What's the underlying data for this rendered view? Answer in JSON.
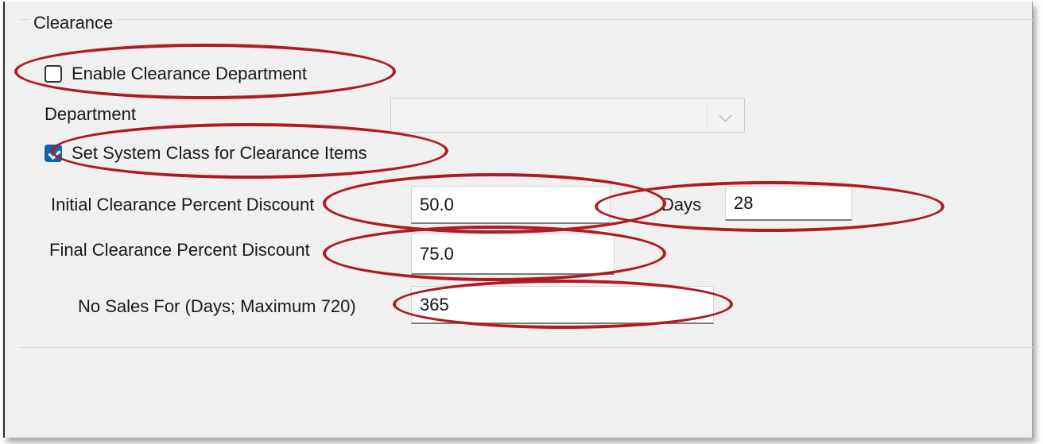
{
  "group": {
    "title": "Clearance"
  },
  "enable_clearance": {
    "label": "Enable Clearance Department",
    "checked": false
  },
  "department": {
    "label": "Department",
    "value": ""
  },
  "set_system_class": {
    "label": "Set System Class for Clearance Items",
    "checked": true
  },
  "initial_discount": {
    "label": "Initial Clearance Percent Discount",
    "value": "50.0"
  },
  "days": {
    "label": "Days",
    "value": "28"
  },
  "final_discount": {
    "label": "Final Clearance Percent Discount",
    "value": "75.0"
  },
  "no_sales": {
    "label": "No Sales For (Days; Maximum 720)",
    "value": "365"
  },
  "colors": {
    "annotation": "#b01a22",
    "checkbox_checked": "#0a64b4",
    "panel_bg": "#f0f0f0"
  }
}
